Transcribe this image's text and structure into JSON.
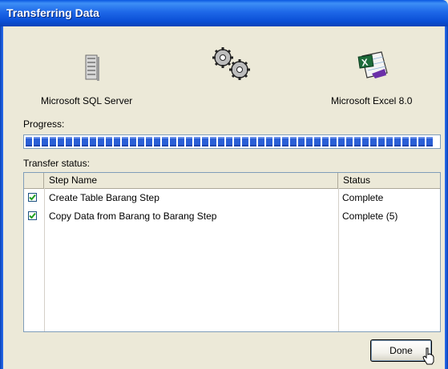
{
  "window": {
    "title": "Transferring Data"
  },
  "source": {
    "label": "Microsoft SQL Server",
    "icon": "server-icon"
  },
  "process": {
    "icon": "gears-icon"
  },
  "destination": {
    "label": "Microsoft Excel 8.0",
    "icon": "excel-icon"
  },
  "progress": {
    "label": "Progress:",
    "value": 1.0
  },
  "transfer": {
    "label": "Transfer status:",
    "columns": [
      "Step Name",
      "Status"
    ],
    "rows": [
      {
        "checked": true,
        "step": "Create Table Barang Step",
        "status": "Complete"
      },
      {
        "checked": true,
        "step": "Copy Data from Barang to Barang Step",
        "status": "Complete (5)"
      }
    ]
  },
  "buttons": {
    "done": "Done"
  },
  "colors": {
    "titlebar": "#0b4fd6",
    "progress": "#2a5fd6",
    "dialog": "#ece9d8"
  }
}
